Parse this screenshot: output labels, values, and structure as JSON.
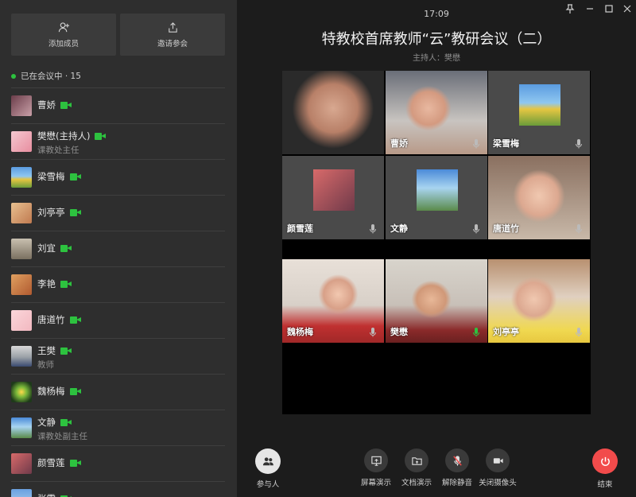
{
  "sidebar": {
    "add_member_label": "添加成员",
    "invite_label": "邀请参会",
    "in_meeting_label": "已在会议中 · 15",
    "members": [
      {
        "name": "曹娇",
        "role": ""
      },
      {
        "name": "樊懋(主持人)",
        "role": "课教处主任"
      },
      {
        "name": "梁雪梅",
        "role": ""
      },
      {
        "name": "刘亭亭",
        "role": ""
      },
      {
        "name": "刘宜",
        "role": ""
      },
      {
        "name": "李艳",
        "role": ""
      },
      {
        "name": "唐道竹",
        "role": ""
      },
      {
        "name": "王樊",
        "role": "教师"
      },
      {
        "name": "魏杨梅",
        "role": ""
      },
      {
        "name": "文静",
        "role": "课教处副主任"
      },
      {
        "name": "颜雪莲",
        "role": ""
      },
      {
        "name": "张雷",
        "role": ""
      }
    ]
  },
  "header": {
    "time": "17:09",
    "title": "特教校首席教师“云”教研会议（二）",
    "host": "主持人：樊懋"
  },
  "tiles": [
    {
      "name": ""
    },
    {
      "name": "曹娇"
    },
    {
      "name": "梁雪梅"
    },
    {
      "name": "颜雪莲"
    },
    {
      "name": "文静"
    },
    {
      "name": "唐道竹"
    },
    {
      "name": "魏杨梅"
    },
    {
      "name": "樊懋"
    },
    {
      "name": "刘亭亭"
    }
  ],
  "toolbar": {
    "participants": "参与人",
    "screen_share": "屏幕演示",
    "doc_share": "文档演示",
    "unmute": "解除静音",
    "camera_off": "关闭摄像头",
    "end": "结束"
  },
  "colors": {
    "accent_green": "#2dc23f",
    "end_red": "#f24b4b"
  }
}
